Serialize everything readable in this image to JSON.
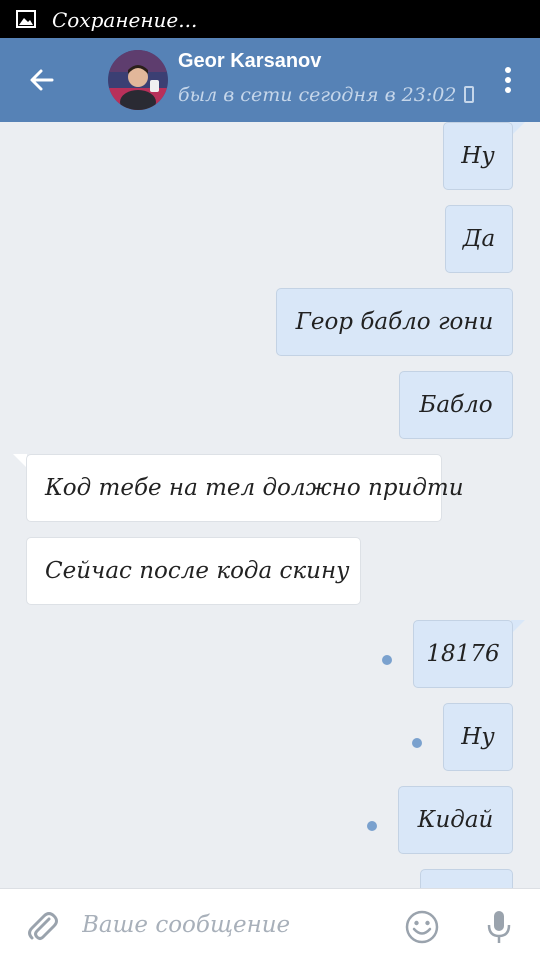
{
  "status_bar": {
    "text": "Сохранение...",
    "icon": "image-icon"
  },
  "header": {
    "back_icon": "arrow-left-icon",
    "contact_name": "Geor Karsanov",
    "contact_status": "был в сети сегодня в 23:02",
    "device_icon": "phone-icon",
    "menu_icon": "more-vertical-icon"
  },
  "messages": [
    {
      "direction": "out",
      "text": "Ну",
      "unread": false
    },
    {
      "direction": "out",
      "text": "Да",
      "unread": false
    },
    {
      "direction": "out",
      "text": "Геор бабло гони",
      "unread": false
    },
    {
      "direction": "out",
      "text": "Бабло",
      "unread": false
    },
    {
      "direction": "in",
      "text": "Код тебе на тел должно придти"
    },
    {
      "direction": "in",
      "text": "Сейчас после кода скину"
    },
    {
      "direction": "out",
      "text": "18176",
      "unread": true
    },
    {
      "direction": "out",
      "text": "Ну",
      "unread": true
    },
    {
      "direction": "out",
      "text": "Кидай",
      "unread": true
    },
    {
      "direction": "out",
      "text": "",
      "unread": false
    }
  ],
  "composer": {
    "placeholder": "Ваше сообщение",
    "attach_icon": "paperclip-icon",
    "emoji_icon": "smiley-icon",
    "mic_icon": "microphone-icon"
  },
  "colors": {
    "header": "#5682b6",
    "outgoing_bubble": "#d9e7f8",
    "incoming_bubble": "#ffffff",
    "chat_background": "#ebeef2",
    "unread_dot": "#7aa1ce"
  }
}
